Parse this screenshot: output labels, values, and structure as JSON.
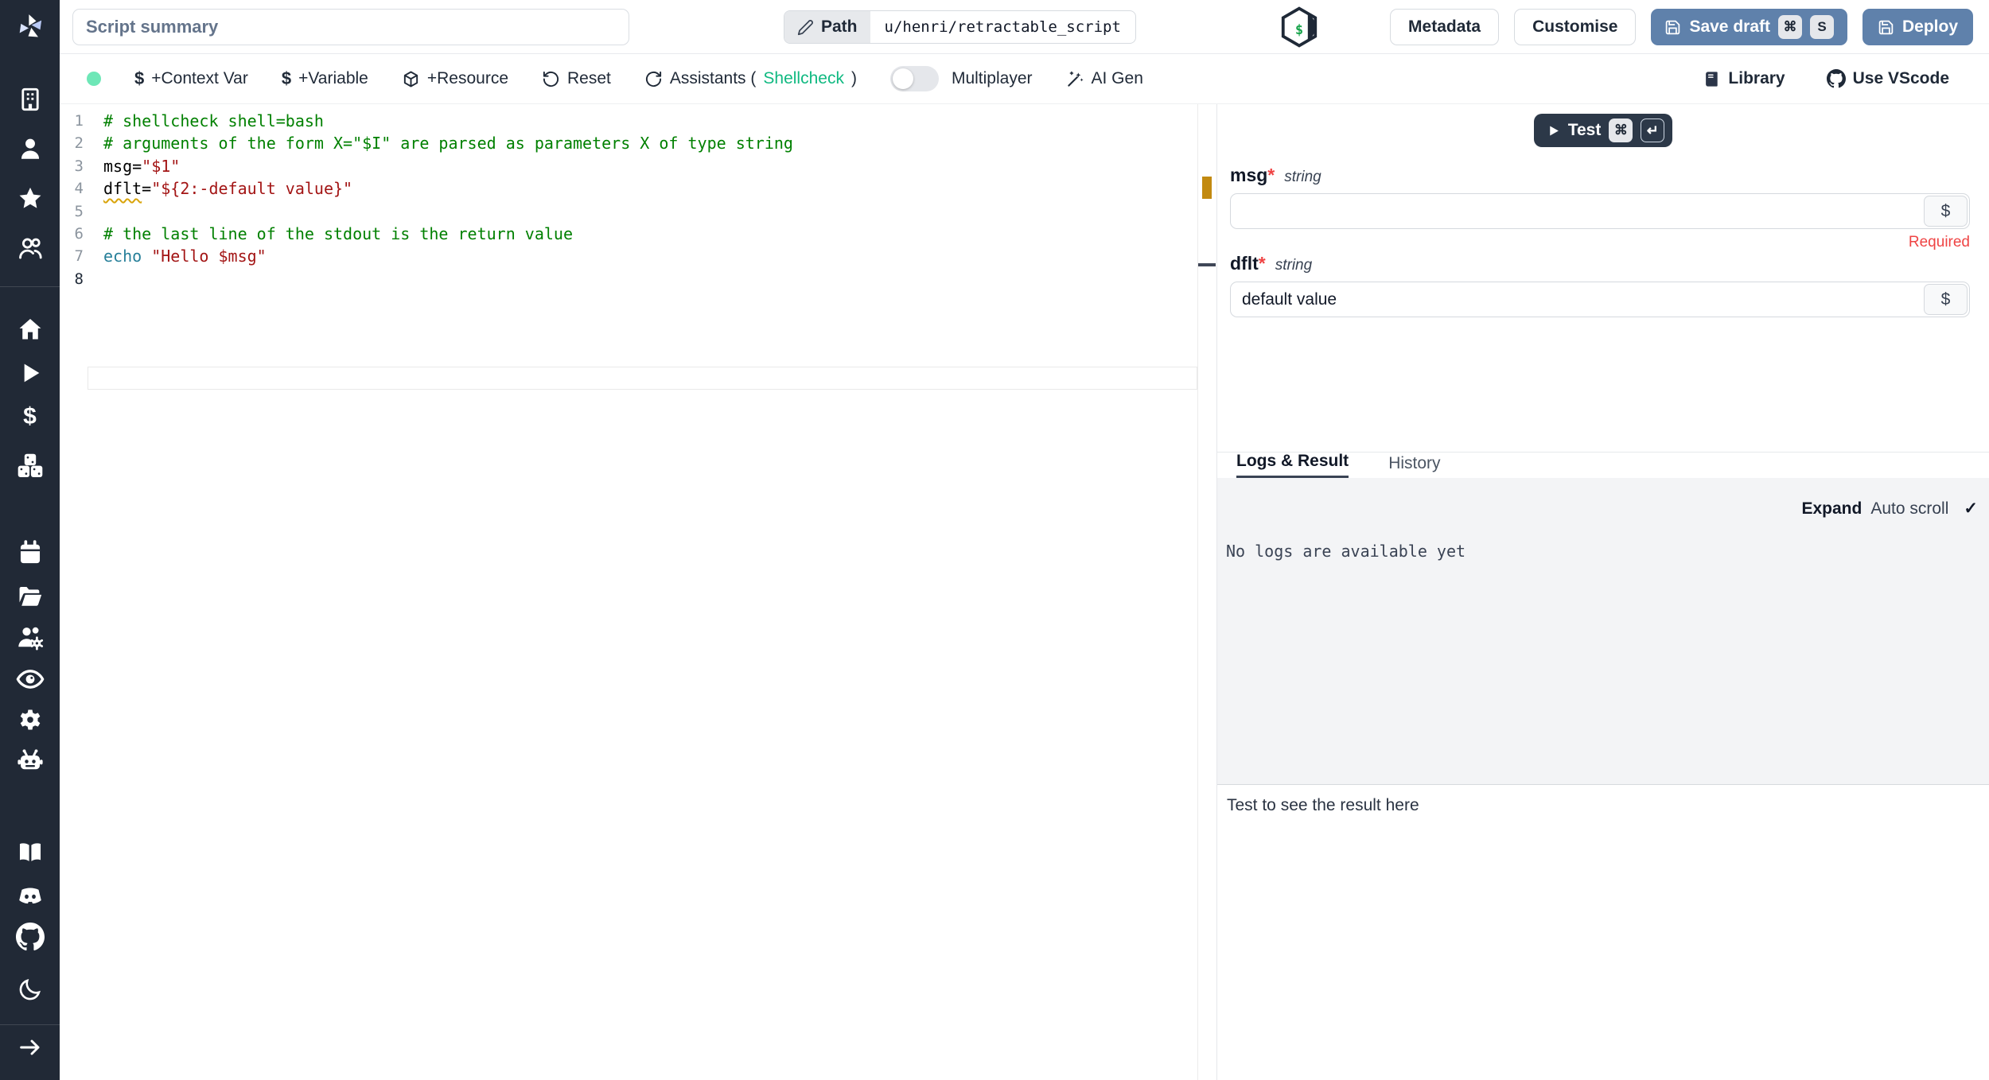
{
  "icons": {
    "dollar": "$",
    "check": "✓"
  },
  "topbar": {
    "summary_placeholder": "Script summary",
    "path_label": "Path",
    "path_value": "u/henri/retractable_script",
    "lang_symbol": "$",
    "metadata_label": "Metadata",
    "customise_label": "Customise",
    "save_draft_label": "Save draft",
    "save_kbd1": "⌘",
    "save_kbd2": "S",
    "deploy_label": "Deploy"
  },
  "toolbar": {
    "context_var_label": "+Context Var",
    "variable_label": "+Variable",
    "resource_label": "+Resource",
    "reset_label": "Reset",
    "assistants_prefix": "Assistants (",
    "assistants_name": "Shellcheck",
    "assistants_suffix": ")",
    "multiplayer_label": "Multiplayer",
    "ai_gen_label": "AI Gen",
    "library_label": "Library",
    "use_vscode_label": "Use VScode"
  },
  "editor": {
    "lines": [
      {
        "n": "1",
        "tokens": [
          {
            "t": "# shellcheck shell=bash",
            "c": "tok-comment"
          }
        ]
      },
      {
        "n": "2",
        "tokens": [
          {
            "t": "# arguments of the form X=\"$I\" are parsed as parameters X of type string",
            "c": "tok-comment"
          }
        ]
      },
      {
        "n": "3",
        "tokens": [
          {
            "t": "msg=",
            "c": "tok-plain"
          },
          {
            "t": "\"$1\"",
            "c": "tok-string"
          }
        ]
      },
      {
        "n": "4",
        "tokens": [
          {
            "t": "dflt",
            "c": "tok-plain tok-warn"
          },
          {
            "t": "=",
            "c": "tok-plain"
          },
          {
            "t": "\"${2:-default value}\"",
            "c": "tok-string"
          }
        ]
      },
      {
        "n": "5",
        "tokens": []
      },
      {
        "n": "6",
        "tokens": [
          {
            "t": "# the last line of the stdout is the return value",
            "c": "tok-comment"
          }
        ]
      },
      {
        "n": "7",
        "tokens": [
          {
            "t": "echo",
            "c": "tok-keyword"
          },
          {
            "t": " ",
            "c": "tok-plain"
          },
          {
            "t": "\"Hello $msg\"",
            "c": "tok-string"
          }
        ]
      },
      {
        "n": "8",
        "tokens": [],
        "current": true
      }
    ]
  },
  "panel": {
    "test_label": "Test",
    "test_kbd1": "⌘",
    "test_kbd2": "↵",
    "fields": [
      {
        "name": "msg",
        "star": "*",
        "type": "string",
        "value": "",
        "dollar": "$",
        "error": "Required"
      },
      {
        "name": "dflt",
        "star": "*",
        "type": "string",
        "value": "default value",
        "dollar": "$"
      }
    ],
    "tabs": [
      {
        "label": "Logs & Result"
      },
      {
        "label": "History"
      }
    ],
    "expand_label": "Expand",
    "autoscroll_label": "Auto scroll",
    "no_logs_text": "No logs are available yet",
    "result_hint": "Test to see the result here"
  }
}
